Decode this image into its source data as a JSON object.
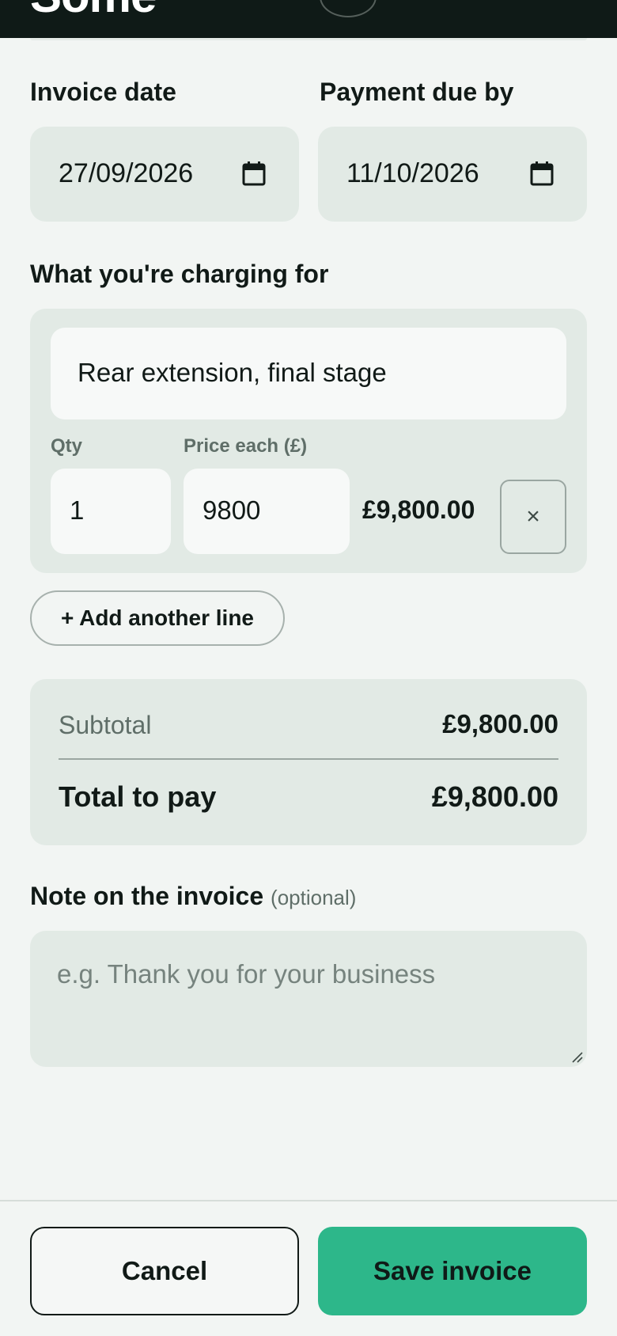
{
  "header": {
    "brand": "Some"
  },
  "dates": {
    "invoice_date_label": "Invoice date",
    "invoice_date_value": "27/09/2026",
    "due_label": "Payment due by",
    "due_value": "11/10/2026"
  },
  "items": {
    "section_label": "What you're charging for",
    "lines": [
      {
        "description": "Rear extension, final stage",
        "qty_label": "Qty",
        "qty": "1",
        "price_label": "Price each (£)",
        "price": "9800",
        "line_total": "£9,800.00",
        "remove_symbol": "×"
      }
    ],
    "add_line_label": "+ Add another line"
  },
  "totals": {
    "subtotal_label": "Subtotal",
    "subtotal_value": "£9,800.00",
    "total_label": "Total to pay",
    "total_value": "£9,800.00"
  },
  "note": {
    "label": "Note on the invoice",
    "optional_text": "(optional)",
    "placeholder": "e.g. Thank you for your business",
    "value": ""
  },
  "footer": {
    "cancel_label": "Cancel",
    "save_label": "Save invoice"
  },
  "colors": {
    "accent": "#2db78a",
    "header_bg": "#0f1a17",
    "field_bg": "#e2eae5",
    "page_bg": "#f2f5f3"
  },
  "icons": {
    "date_picker": "calendar-icon",
    "remove_line": "close-icon",
    "resize": "resize-grip-icon"
  }
}
